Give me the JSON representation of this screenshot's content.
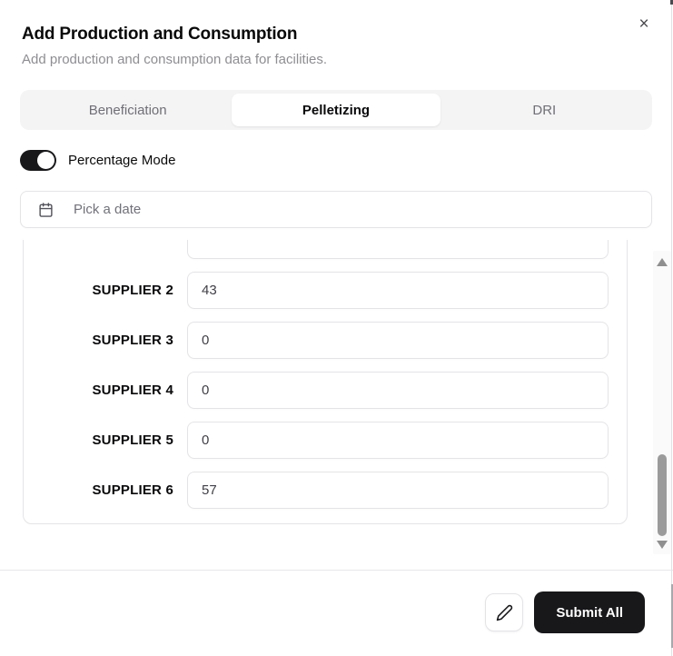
{
  "dialog": {
    "title": "Add Production and Consumption",
    "subtitle": "Add production and consumption data for facilities.",
    "close_glyph": "×"
  },
  "tabs": {
    "active": "Pelletizing",
    "items": [
      {
        "label": "Beneficiation"
      },
      {
        "label": "Pelletizing"
      },
      {
        "label": "DRI"
      }
    ]
  },
  "toggle": {
    "label": "Percentage Mode",
    "state": "on"
  },
  "date_picker": {
    "placeholder": "Pick a date",
    "icon": "calendar-icon"
  },
  "suppliers": {
    "rows": [
      {
        "label": "SUPPLIER 2",
        "value": "43"
      },
      {
        "label": "SUPPLIER 3",
        "value": "0"
      },
      {
        "label": "SUPPLIER 4",
        "value": "0"
      },
      {
        "label": "SUPPLIER 5",
        "value": "0"
      },
      {
        "label": "SUPPLIER 6",
        "value": "57"
      }
    ]
  },
  "footer": {
    "edit_icon": "pencil-icon",
    "submit_label": "Submit All"
  },
  "colors": {
    "accent": "#18181b",
    "border": "#e4e4e7",
    "muted_text": "#71717a",
    "subtitle_text": "#8e8e93",
    "tab_bg": "#f4f4f5",
    "scroll_thumb": "#9b9b9b"
  }
}
